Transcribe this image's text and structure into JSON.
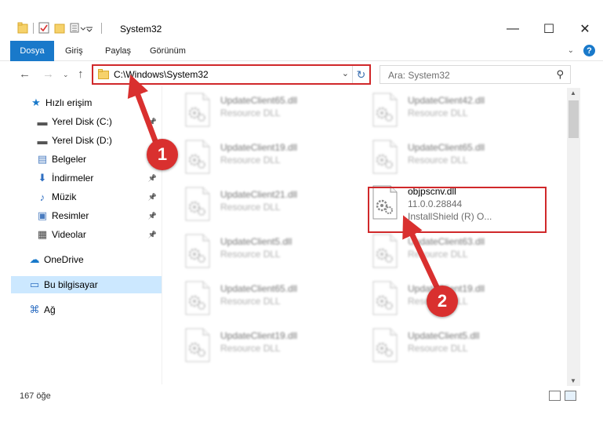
{
  "window": {
    "title": "System32",
    "controls": {
      "minimize": "—",
      "maximize": "☐",
      "close": "✕"
    }
  },
  "ribbon": {
    "tabs": [
      "Dosya",
      "Giriş",
      "Paylaş",
      "Görünüm"
    ]
  },
  "address": {
    "path": "C:\\Windows\\System32",
    "search_placeholder": "Ara: System32"
  },
  "nav": {
    "items": [
      {
        "label": "Hızlı erişim",
        "icon": "star-icon",
        "pinned": false
      },
      {
        "label": "Yerel Disk (C:)",
        "icon": "drive-icon",
        "pinned": true
      },
      {
        "label": "Yerel Disk (D:)",
        "icon": "drive-icon",
        "pinned": false
      },
      {
        "label": "Belgeler",
        "icon": "documents-icon",
        "pinned": true
      },
      {
        "label": "İndirmeler",
        "icon": "download-icon",
        "pinned": true
      },
      {
        "label": "Müzik",
        "icon": "music-icon",
        "pinned": true
      },
      {
        "label": "Resimler",
        "icon": "pictures-icon",
        "pinned": true
      },
      {
        "label": "Videolar",
        "icon": "videos-icon",
        "pinned": true
      },
      {
        "label": "OneDrive",
        "icon": "cloud-icon",
        "pinned": false
      },
      {
        "label": "Bu bilgisayar",
        "icon": "computer-icon",
        "pinned": false,
        "selected": true
      },
      {
        "label": "Ağ",
        "icon": "network-icon",
        "pinned": false
      }
    ]
  },
  "files": [
    {
      "name": "UpdateClient65.dll",
      "desc": "Resource DLL",
      "blurred": true
    },
    {
      "name": "UpdateClient42.dll",
      "desc": "Resource DLL",
      "blurred": true
    },
    {
      "name": "UpdateClient19.dll",
      "desc": "Resource DLL",
      "blurred": true
    },
    {
      "name": "UpdateClient65.dll",
      "desc": "Resource DLL",
      "blurred": true
    },
    {
      "name": "UpdateClient21.dll",
      "desc": "Resource DLL",
      "blurred": true
    },
    {
      "name": "objpscnv.dll",
      "desc": "11.0.0.28844",
      "desc2": "InstallShield (R) O...",
      "blurred": false
    },
    {
      "name": "UpdateClient5.dll",
      "desc": "Resource DLL",
      "blurred": true
    },
    {
      "name": "UpdateClient63.dll",
      "desc": "Resource DLL",
      "blurred": true
    },
    {
      "name": "UpdateClient65.dll",
      "desc": "Resource DLL",
      "blurred": true
    },
    {
      "name": "UpdateClient19.dll",
      "desc": "Resource DLL",
      "blurred": true
    },
    {
      "name": "UpdateClient19.dll",
      "desc": "Resource DLL",
      "blurred": true
    },
    {
      "name": "UpdateClient5.dll",
      "desc": "Resource DLL",
      "blurred": true
    }
  ],
  "status": {
    "count": "167 öğe"
  },
  "callouts": [
    "1",
    "2"
  ],
  "colors": {
    "accent": "#1979ca",
    "highlight": "#d0282a",
    "selected": "#cce8ff"
  }
}
